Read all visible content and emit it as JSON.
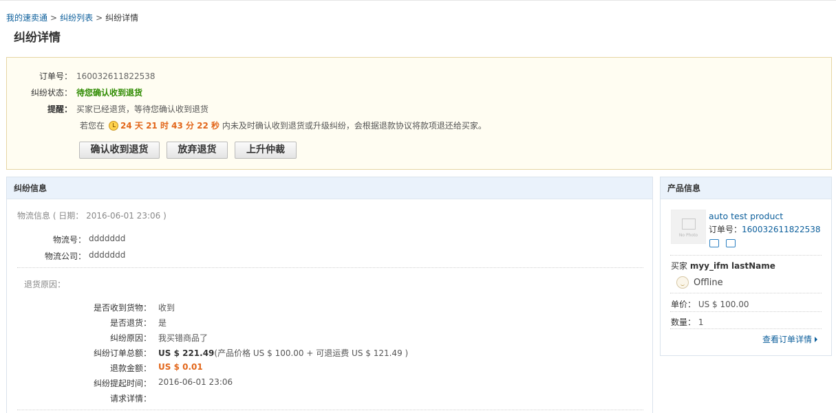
{
  "breadcrumb": {
    "home": "我的速卖通",
    "list": "纠纷列表",
    "current": "纠纷详情",
    "separator": ">"
  },
  "page_title": "纠纷详情",
  "status": {
    "order_label": "订单号：",
    "order_no": "160032611822538",
    "state_label": "纠纷状态：",
    "state": "待您确认收到退货",
    "reminder_label": "提醒：",
    "reminder": "买家已经退货，等待您确认收到退货",
    "deadline_prefix": "若您在",
    "countdown": "24 天 21 时 43 分 22 秒",
    "deadline_suffix": "内未及时确认收到退货或升级纠纷，会根据退款协议将款项退还给买家。",
    "buttons": {
      "confirm": "确认收到退货",
      "abandon": "放弃退货",
      "escalate": "上升仲裁"
    }
  },
  "dispute": {
    "title": "纠纷信息",
    "logistics_header": "物流信息 ( 日期： 2016-06-01 23:06 )",
    "tracking_label": "物流号：",
    "tracking_value": "ddddddd",
    "carrier_label": "物流公司：",
    "carrier_value": "ddddddd",
    "reason_header": "退货原因：",
    "rows": [
      {
        "label": "是否收到货物：",
        "value": "收到"
      },
      {
        "label": "是否退货：",
        "value": "是"
      },
      {
        "label": "纠纷原因：",
        "value": "我买错商品了"
      },
      {
        "label": "纠纷订单总额：",
        "value_bold": "US $ 221.49",
        "value_extra": "(产品价格 US $ 100.00 + 可退运费 US $ 121.49 )"
      },
      {
        "label": "退款金额：",
        "value_orange": "US $ 0.01"
      },
      {
        "label": "纠纷提起时间：",
        "value": "2016-06-01 23:06"
      },
      {
        "label": "请求详情：",
        "value": ""
      }
    ]
  },
  "product": {
    "title": "产品信息",
    "image_caption": "No Photo",
    "name": "auto test product",
    "order_label": "订单号：",
    "order_no": "160032611822538",
    "buyer_label": "买家",
    "buyer_name": "myy_ifm lastName",
    "buyer_status": "Offline",
    "price_label": "单价：",
    "price": "US $ 100.00",
    "qty_label": "数量：",
    "qty": "1",
    "view_order": "查看订单详情"
  },
  "colors": {
    "link": "#0b5e9b",
    "status_green": "#2e8b00",
    "accent_orange": "#e2661a",
    "panel_header": "#eaf2fb"
  }
}
